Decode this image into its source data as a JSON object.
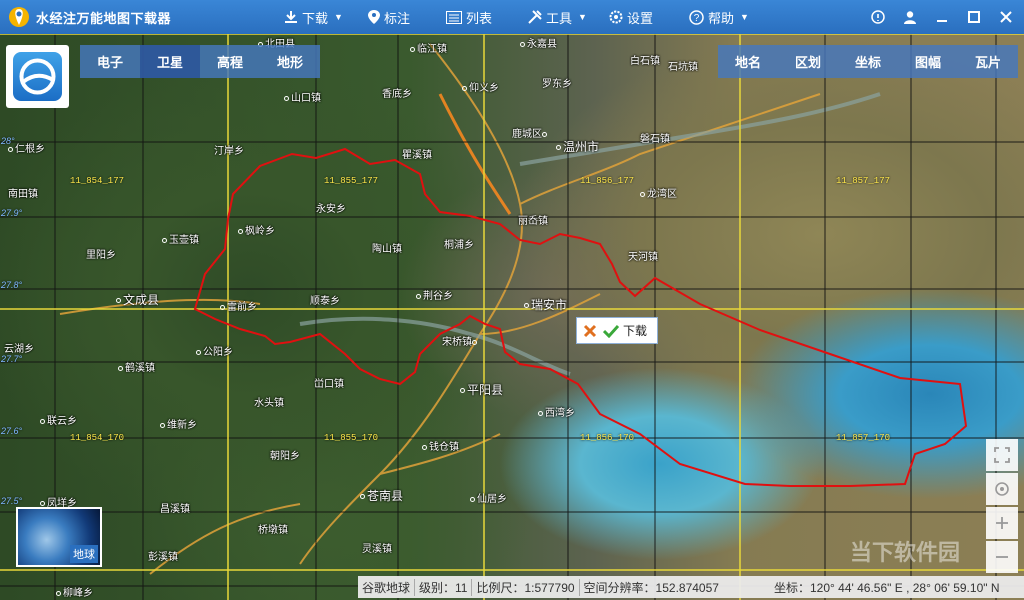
{
  "app": {
    "title": "水经注万能地图下载器"
  },
  "menu": {
    "download": "下载",
    "mark": "标注",
    "list": "列表",
    "tools": "工具",
    "settings": "设置",
    "help": "帮助"
  },
  "map_tabs": [
    "电子",
    "卫星",
    "高程",
    "地形"
  ],
  "active_tab": "卫星",
  "right_tabs": [
    "地名",
    "区划",
    "坐标",
    "图幅",
    "瓦片"
  ],
  "places": [
    {
      "name": "北田县",
      "big": false
    },
    {
      "name": "临江镇",
      "big": false
    },
    {
      "name": "永嘉县",
      "big": false
    },
    {
      "name": "石坑镇",
      "big": false
    },
    {
      "name": "山口镇",
      "big": false
    },
    {
      "name": "香底乡",
      "big": false
    },
    {
      "name": "仰义乡",
      "big": false
    },
    {
      "name": "罗东乡",
      "big": false
    },
    {
      "name": "白石镇",
      "big": false
    },
    {
      "name": "鹿城区",
      "big": false
    },
    {
      "name": "温州市",
      "big": true
    },
    {
      "name": "磐石镇",
      "big": false
    },
    {
      "name": "仁根乡",
      "big": false
    },
    {
      "name": "汀岸乡",
      "big": false
    },
    {
      "name": "瞿溪镇",
      "big": false
    },
    {
      "name": "南田镇",
      "big": false
    },
    {
      "name": "龙湾区",
      "big": false
    },
    {
      "name": "永安乡",
      "big": false
    },
    {
      "name": "丽岙镇",
      "big": false
    },
    {
      "name": "枫岭乡",
      "big": false
    },
    {
      "name": "玉壶镇",
      "big": false
    },
    {
      "name": "陶山镇",
      "big": false
    },
    {
      "name": "桐浦乡",
      "big": false
    },
    {
      "name": "天河镇",
      "big": false
    },
    {
      "name": "里阳乡",
      "big": false
    },
    {
      "name": "文成县",
      "big": true
    },
    {
      "name": "雷前乡",
      "big": false
    },
    {
      "name": "顺泰乡",
      "big": false
    },
    {
      "name": "荆谷乡",
      "big": false
    },
    {
      "name": "瑞安市",
      "big": true
    },
    {
      "name": "云湖乡",
      "big": false
    },
    {
      "name": "公阳乡",
      "big": false
    },
    {
      "name": "宋桥镇",
      "big": false
    },
    {
      "name": "峃口镇",
      "big": false
    },
    {
      "name": "鹤溪镇",
      "big": false
    },
    {
      "name": "平阳县",
      "big": true
    },
    {
      "name": "水头镇",
      "big": false
    },
    {
      "name": "西湾乡",
      "big": false
    },
    {
      "name": "联云乡",
      "big": false
    },
    {
      "name": "维新乡",
      "big": false
    },
    {
      "name": "钱仓镇",
      "big": false
    },
    {
      "name": "朝阳乡",
      "big": false
    },
    {
      "name": "凤垟乡",
      "big": false
    },
    {
      "name": "苍南县",
      "big": true
    },
    {
      "name": "仙居乡",
      "big": false
    },
    {
      "name": "昌溪镇",
      "big": false
    },
    {
      "name": "桥墩镇",
      "big": false
    },
    {
      "name": "彭溪镇",
      "big": false
    },
    {
      "name": "灵溪镇",
      "big": false
    },
    {
      "name": "柳峰乡",
      "big": false
    }
  ],
  "tiles": [
    "11_854_177",
    "11_855_177",
    "11_856_177",
    "11_857_177",
    "11_854_170",
    "11_855_170",
    "11_856_170",
    "11_857_170"
  ],
  "lat_labels": [
    "28°",
    "27.9°",
    "27.8°",
    "27.7°",
    "27.6°",
    "27.5°"
  ],
  "popup": {
    "label": "下载"
  },
  "globe": {
    "label": "地球"
  },
  "status": {
    "source": "谷歌地球",
    "level": "级别：11",
    "scale": "比例尺：1:577790",
    "resolution": "空间分辨率：152.874057",
    "coords": "坐标：120° 44' 46.56\" E , 28° 06' 59.10\" N"
  },
  "watermark": "当下软件园",
  "colors": {
    "titlebar": "#2a6fbf",
    "boundary": "#e01010",
    "grid_yellow": "#e8d83a",
    "grid_black": "#111111"
  }
}
